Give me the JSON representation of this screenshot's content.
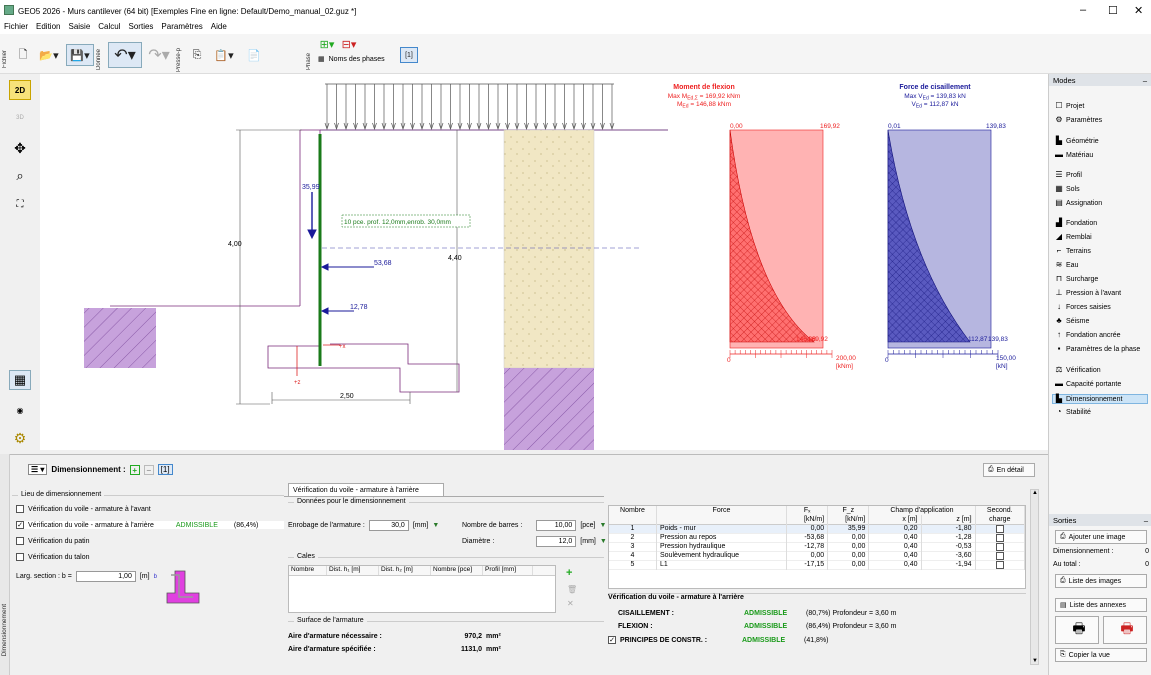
{
  "window": {
    "title": "GEO5 2026 - Murs cantilever (64 bit) [Exemples Fine en ligne: Default/Demo_manual_02.guz *]",
    "minimize": "–",
    "maximize": "☐",
    "close": "✕"
  },
  "menu": [
    "Fichier",
    "Edition",
    "Saisie",
    "Calcul",
    "Sorties",
    "Paramètres",
    "Aide"
  ],
  "toolbar": {
    "fichier": "Fichier",
    "donnee": "Donnée",
    "presse": "Presse-p",
    "phase": "Phase",
    "noms_phases": "Noms des phases",
    "phase_num": "[1]"
  },
  "left_tools": {
    "two_d": "2D",
    "three_d": "3D"
  },
  "drawing": {
    "dim_height": "4,00",
    "dim_height2": "4,40",
    "dim_base": "2,50",
    "f1": "35,99",
    "f2": "53,68",
    "f3": "12,78",
    "rebar_label": "10 pce. prof. 12,0mm,enrob. 30,0mm",
    "x_arrow": "+x",
    "z_arrow": "+z"
  },
  "moment_chart": {
    "title": "Moment de flexion",
    "line1": "Max M",
    "line1_sub": "Ed,Σ",
    "line1_val": " = 169,92 kNm",
    "line2": "M",
    "line2_sub": "Ed",
    "line2_val": " = 146,88 kNm",
    "top_left": "0,00",
    "top_right": "169,92",
    "bottom_val": "146,88",
    "bottom_val2": "169,92",
    "axis_zero": "0",
    "axis_max": "200,00",
    "unit": "[kNm]",
    "color": "#ff4d4d"
  },
  "shear_chart": {
    "title": "Force de cisaillement",
    "line1": "Max V",
    "line1_sub": "Ed",
    "line1_val": " = 139,83 kN",
    "line2": "V",
    "line2_sub": "Ed",
    "line2_val": " = 112,87 kN",
    "top_left": "0,01",
    "top_right": "139,83",
    "bottom_val": "112,87",
    "bottom_val2": "139,83",
    "axis_zero": "0",
    "axis_max": "150,00",
    "unit": "[kN]",
    "color": "#3a3ab0"
  },
  "modes": {
    "header": "Modes",
    "pin": "–",
    "items": [
      {
        "label": "Projet",
        "icon": "☐"
      },
      {
        "label": "Paramètres",
        "icon": "⚙"
      },
      {
        "label": "Géométrie",
        "icon": "▙"
      },
      {
        "label": "Matériau",
        "icon": "▬"
      },
      {
        "label": "Profil",
        "icon": "☰"
      },
      {
        "label": "Sols",
        "icon": "▦"
      },
      {
        "label": "Assignation",
        "icon": "▤"
      },
      {
        "label": "Fondation",
        "icon": "▟"
      },
      {
        "label": "Remblai",
        "icon": "◢"
      },
      {
        "label": "Terrains",
        "icon": "⌐"
      },
      {
        "label": "Eau",
        "icon": "≋"
      },
      {
        "label": "Surcharge",
        "icon": "⊓"
      },
      {
        "label": "Pression à l'avant",
        "icon": "⊥"
      },
      {
        "label": "Forces saisies",
        "icon": "↓"
      },
      {
        "label": "Séisme",
        "icon": "♣"
      },
      {
        "label": "Fondation ancrée",
        "icon": "↑"
      },
      {
        "label": "Paramètres de la phase",
        "icon": "▪"
      },
      {
        "label": "Vérification",
        "icon": "⚖"
      },
      {
        "label": "Capacité portante",
        "icon": "▬"
      },
      {
        "label": "Dimensionnement",
        "icon": "▙"
      },
      {
        "label": "Stabilité",
        "icon": "◔"
      }
    ],
    "selected": "Dimensionnement"
  },
  "sorties": {
    "header": "Sorties",
    "pin": "–",
    "add_image": "Ajouter une image",
    "dim_label": "Dimensionnement :",
    "dim_val": "0",
    "total_label": "Au total :",
    "total_val": "0",
    "list_images": "Liste des images",
    "list_annexes": "Liste des annexes",
    "copy_view": "Copier la vue"
  },
  "bottom": {
    "side_tab": "Dimensionnement",
    "title": "Dimensionnement :",
    "phase": "[1]",
    "detail_btn": "En détail",
    "lieu_title": "Lieu de dimensionnement",
    "checks": [
      {
        "label": "Vérification du voile - armature à l'avant",
        "checked": false
      },
      {
        "label": "Vérification du voile - armature à l'arrière",
        "checked": true,
        "status": "ADMISSIBLE",
        "pct": "(86,4%)"
      },
      {
        "label": "Vérification du patin",
        "checked": false
      },
      {
        "label": "Vérification du talon",
        "checked": false
      }
    ],
    "larg_label": "Larg. section : b  =",
    "larg_val": "1,00",
    "larg_unit": "[m]",
    "b_label": "b",
    "tab": "Vérification du voile - armature à l'arrière",
    "donnees_title": "Données pour le dimensionnement",
    "enrob_label": "Enrobage de l'armature :",
    "enrob_val": "30,0",
    "enrob_unit": "[mm]",
    "nb_label": "Nombre de barres :",
    "nb_val": "10,00",
    "nb_unit": "[pce]",
    "diam_label": "Diamètre :",
    "diam_val": "12,0",
    "diam_unit": "[mm]",
    "cales_title": "Cales",
    "cales_cols": [
      "Nombre",
      "Dist. h₁ [m]",
      "Dist. h₂ [m]",
      "Nombre [pce]",
      "Profil [mm]"
    ],
    "surface_title": "Surface de l'armature",
    "aire_nec_label": "Aire d'armature nécessaire :",
    "aire_nec_val": "970,2",
    "aire_nec_unit": "mm²",
    "aire_spec_label": "Aire d'armature spécifiée :",
    "aire_spec_val": "1131,0",
    "aire_spec_unit": "mm²",
    "force_cols": [
      "Nombre",
      "Force",
      "Fₓ",
      "F_z",
      "Champ d'application",
      "",
      "Second."
    ],
    "force_cols2": [
      "",
      "",
      "[kN/m]",
      "[kN/m]",
      "x [m]",
      "z [m]",
      "charge"
    ],
    "forces": [
      [
        "1",
        "Poids - mur",
        "0,00",
        "35,99",
        "0,20",
        "-1,80"
      ],
      [
        "2",
        "Pression au repos",
        "-53,68",
        "0,00",
        "0,40",
        "-1,28"
      ],
      [
        "3",
        "Pression hydraulique",
        "-12,78",
        "0,00",
        "0,40",
        "-0,53"
      ],
      [
        "4",
        "Soulèvement hydraulique",
        "0,00",
        "0,00",
        "0,40",
        "-3,60"
      ],
      [
        "5",
        "L1",
        "-17,15",
        "0,00",
        "0,40",
        "-1,94"
      ]
    ],
    "verif_title": "Vérification du voile - armature à l'arrière",
    "verifs": [
      {
        "label": "CISAILLEMENT :",
        "status": "ADMISSIBLE",
        "detail": "(80,7%)  Profondeur = 3,60 m"
      },
      {
        "label": "FLEXION :",
        "status": "ADMISSIBLE",
        "detail": "(86,4%)  Profondeur = 3,60 m"
      },
      {
        "label": "PRINCIPES DE CONSTR. :",
        "status": "ADMISSIBLE",
        "detail": "(41,8%)"
      }
    ]
  }
}
